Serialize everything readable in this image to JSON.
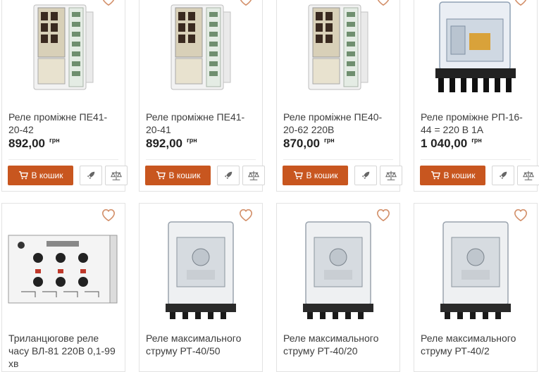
{
  "colors": {
    "accent": "#c8561f",
    "heart": "#d3906a",
    "text": "#3d3d3d"
  },
  "labels": {
    "buy": "В кошик",
    "currency": "грн"
  },
  "products": [
    {
      "name": "Реле проміжне ПЕ41-20-42",
      "price": "892,00",
      "image_icon": "relay-pe-icon"
    },
    {
      "name": "Реле проміжне ПЕ41-20-41",
      "price": "892,00",
      "image_icon": "relay-pe-icon"
    },
    {
      "name": "Реле проміжне ПЕ40-20-62 220В",
      "price": "870,00",
      "image_icon": "relay-pe-icon"
    },
    {
      "name": "Реле проміжне РП-16-44 = 220 В 1А",
      "price": "1 040,00",
      "image_icon": "relay-rp-icon"
    },
    {
      "name": "Триланцюгове реле часу ВЛ-81 220В 0,1-99 хв",
      "price": "",
      "image_icon": "timer-relay-icon"
    },
    {
      "name": "Реле максимального струму РТ-40/50",
      "price": "",
      "image_icon": "relay-rt-icon"
    },
    {
      "name": "Реле максимального струму РТ-40/20",
      "price": "",
      "image_icon": "relay-rt-icon"
    },
    {
      "name": "Реле максимального струму РТ-40/2",
      "price": "",
      "image_icon": "relay-rt-icon"
    }
  ]
}
